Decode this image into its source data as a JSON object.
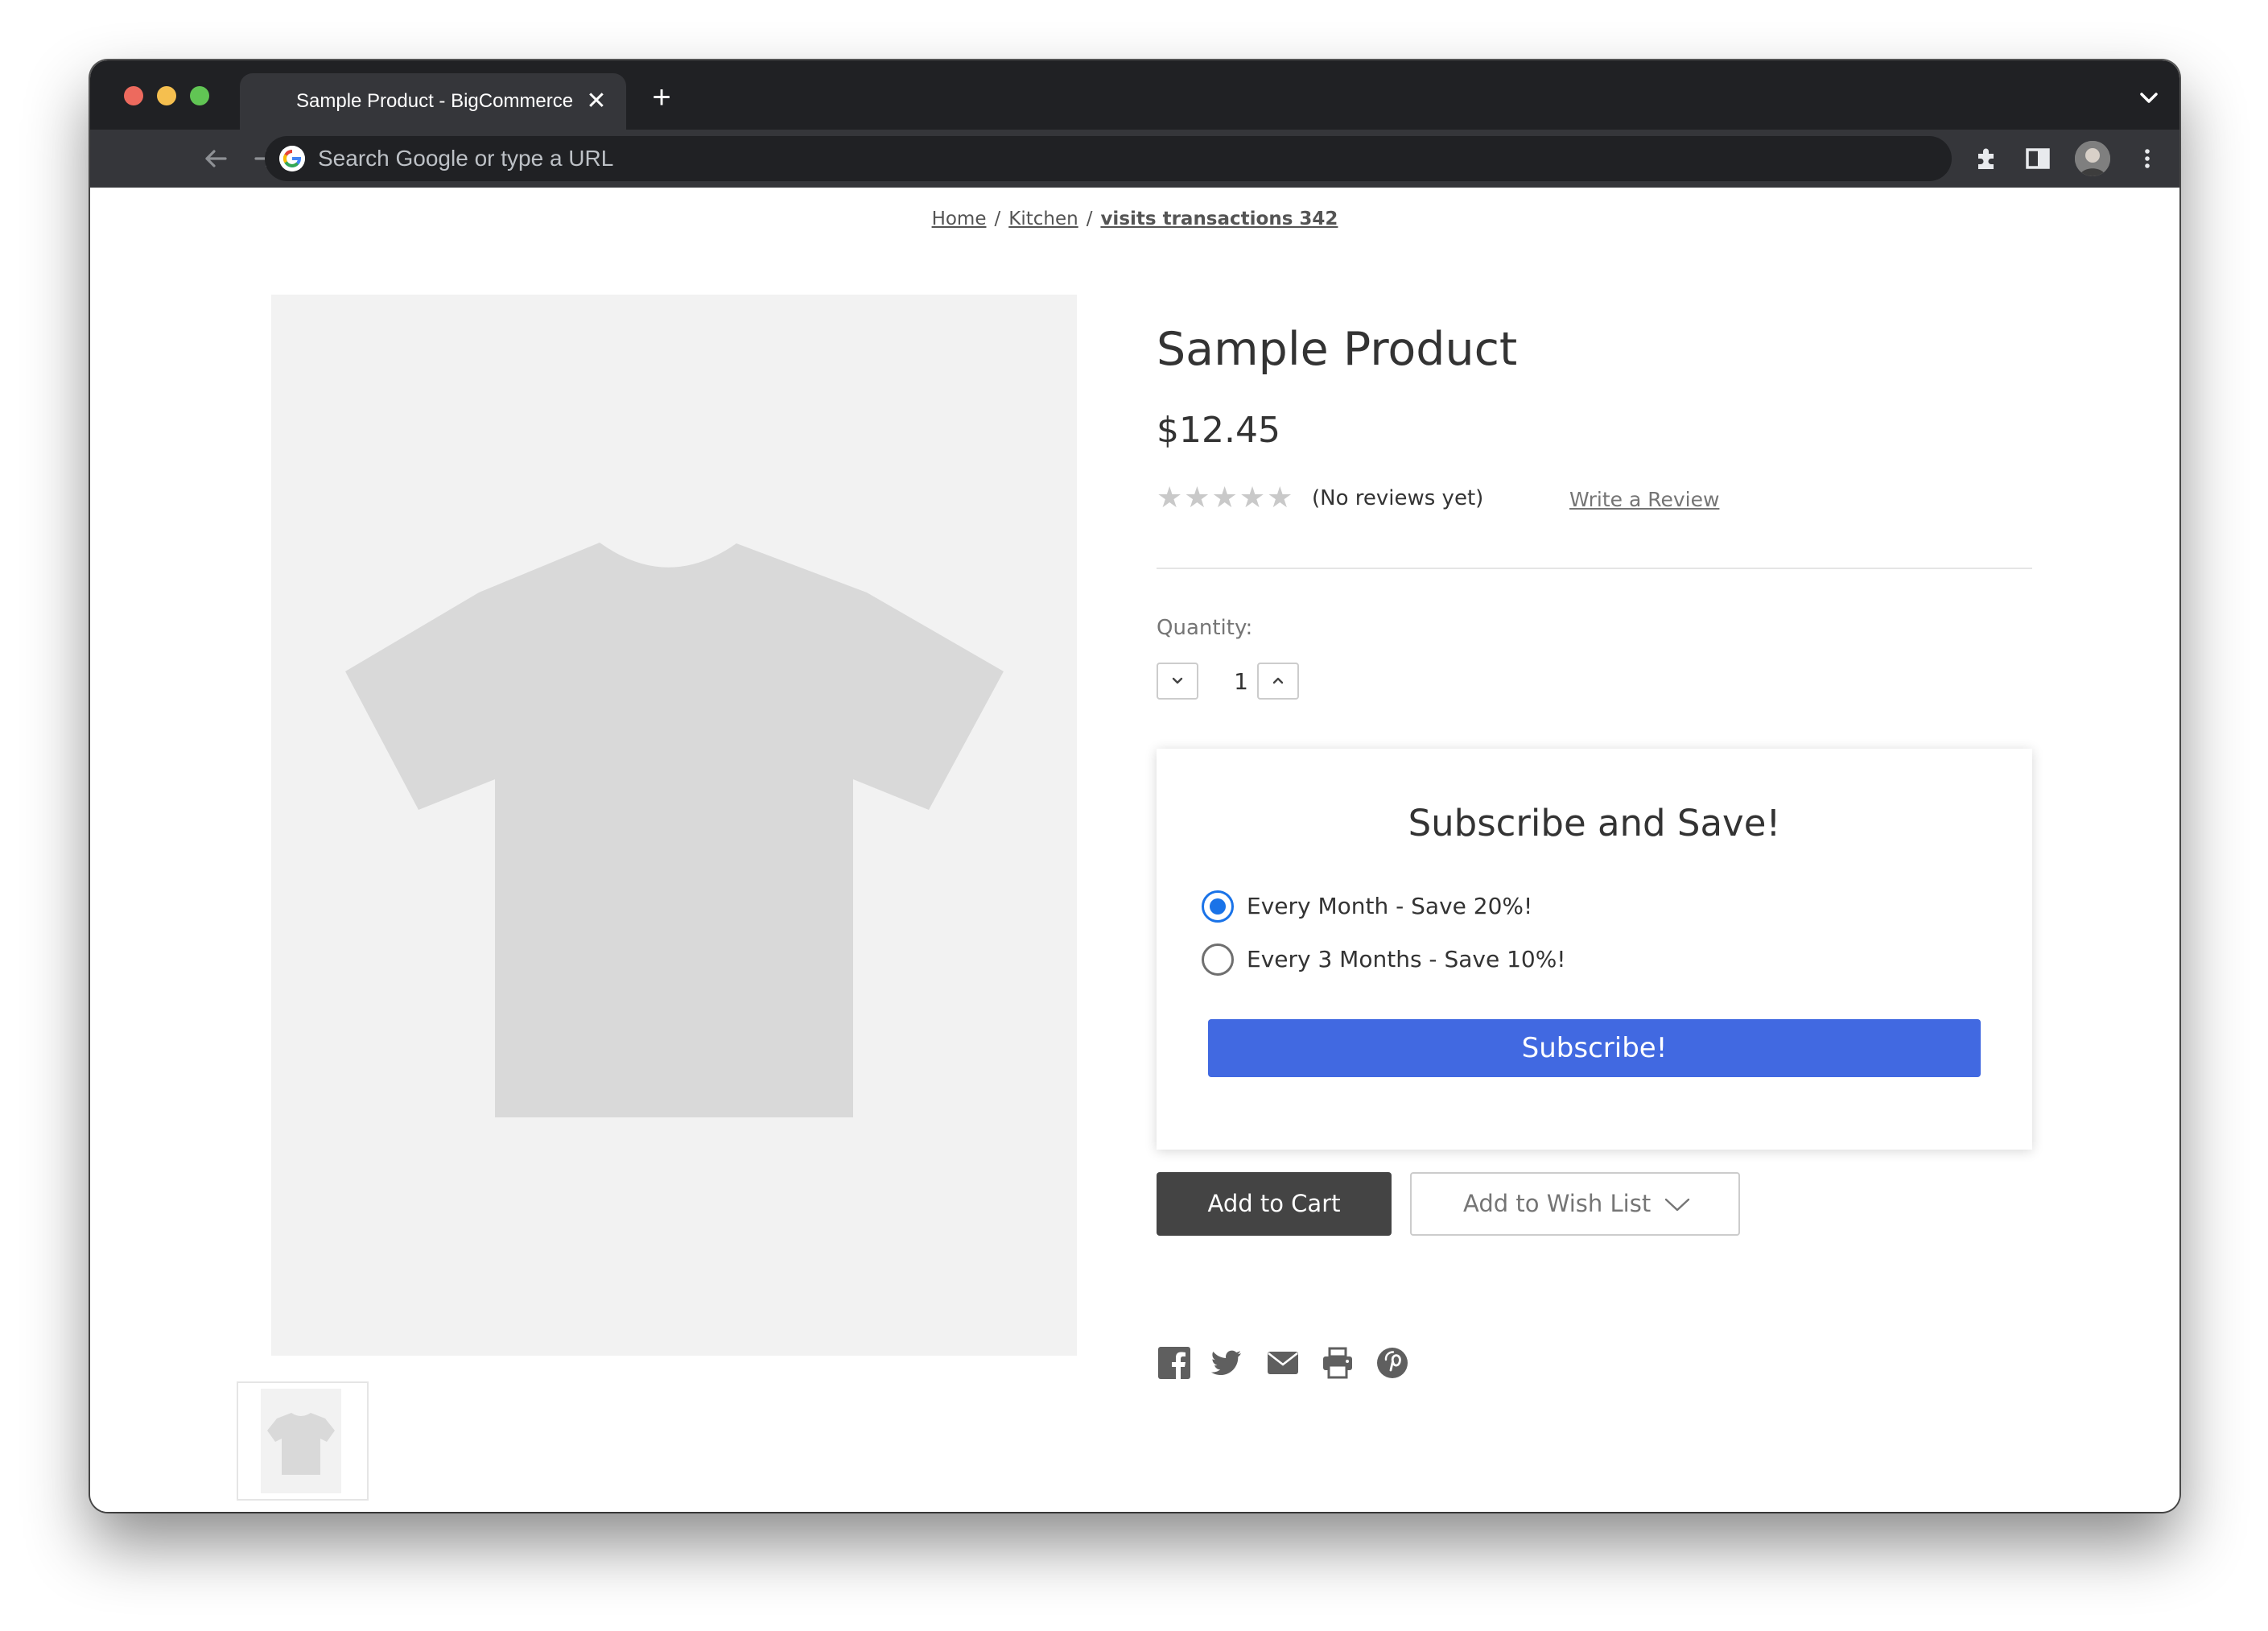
{
  "browser": {
    "tab_title": "Sample Product - BigCommerce",
    "tab_close": "✕",
    "new_tab": "+",
    "omnibox_placeholder": "Search Google or type a URL"
  },
  "breadcrumb": {
    "items": [
      "Home",
      "Kitchen",
      "visits transactions 342"
    ],
    "separator": "/"
  },
  "product": {
    "title": "Sample Product",
    "price": "$12.45",
    "rating": 0,
    "stars": "★★★★★",
    "reviews_text": "(No reviews yet)",
    "write_review": "Write a Review",
    "quantity_label": "Quantity:",
    "quantity_value": "1"
  },
  "subscribe": {
    "title": "Subscribe and Save!",
    "options": [
      {
        "label": "Every Month - Save 20%!",
        "selected": true
      },
      {
        "label": "Every 3 Months - Save 10%!",
        "selected": false
      }
    ],
    "button": "Subscribe!"
  },
  "actions": {
    "add_to_cart": "Add to Cart",
    "add_to_wishlist": "Add to Wish List"
  },
  "social": [
    "facebook-icon",
    "twitter-icon",
    "email-icon",
    "print-icon",
    "pinterest-icon"
  ],
  "colors": {
    "subscribe_button": "#4169e1",
    "add_to_cart": "#444444",
    "radio_selected": "#1a73e8",
    "placeholder_image": "#f2f2f2",
    "tshirt": "#d9d9d9"
  }
}
